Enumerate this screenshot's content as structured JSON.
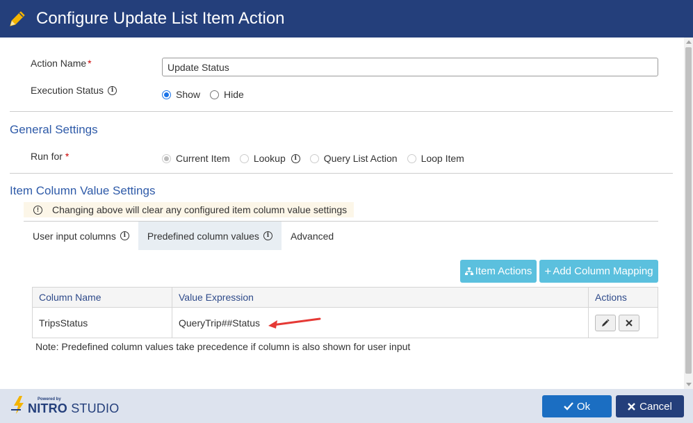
{
  "dialog": {
    "title": "Configure Update List Item Action"
  },
  "form": {
    "action_name_label": "Action Name",
    "required_mark": "*",
    "action_name_value": "Update Status",
    "execution_status_label": "Execution Status",
    "execution_status_options": [
      "Show",
      "Hide"
    ],
    "execution_status_selected": "Show"
  },
  "general_settings": {
    "heading": "General Settings",
    "run_for_label": "Run for",
    "run_for_options": [
      "Current Item",
      "Lookup",
      "Query List Action",
      "Loop Item"
    ],
    "run_for_selected": "Current Item"
  },
  "item_column": {
    "heading": "Item Column Value Settings",
    "warning": "Changing above will clear any configured item column value settings",
    "tabs": [
      "User input columns",
      "Predefined column values",
      "Advanced"
    ],
    "active_tab": "Predefined column values",
    "item_actions_label": "Item Actions",
    "add_mapping_label": "Add Column Mapping",
    "columns": [
      "Column Name",
      "Value Expression",
      "Actions"
    ],
    "rows": [
      {
        "column_name": "TripsStatus",
        "value_expression": "QueryTrip##Status"
      }
    ],
    "note": "Note: Predefined column values take precedence if column is also shown for user input"
  },
  "footer": {
    "logo_powered": "Powered by",
    "logo_name": "NITRO",
    "logo_studio": "STUDIO",
    "ok_label": "Ok",
    "cancel_label": "Cancel"
  },
  "colors": {
    "title_bar": "#243f7b",
    "section_heading": "#2e5aa8",
    "teal_button": "#5bc0de",
    "ok_button": "#1b6ec2",
    "annotation_arrow": "#e53935"
  },
  "icons": [
    "pencil-icon",
    "info-icon",
    "warning-icon",
    "sitemap-icon",
    "plus-icon",
    "edit-icon",
    "close-icon",
    "check-icon",
    "times-icon",
    "nitro-logo-icon"
  ]
}
